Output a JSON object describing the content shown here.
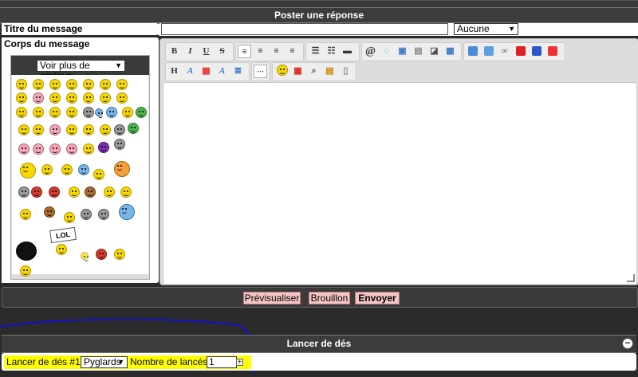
{
  "header": {
    "title": "Poster une réponse"
  },
  "form": {
    "title_label": "Titre du message",
    "title_value": "",
    "icon_select": "Aucune",
    "body_label": "Corps du message",
    "smileys_select": "Voir plus de smileys",
    "lol_sign": "LOL"
  },
  "toolbar": {
    "row1": [
      "bold",
      "italic",
      "underline",
      "strikethrough",
      "align-left",
      "align-center",
      "align-right",
      "justify",
      "bullet-list",
      "numbered-list",
      "horizontal-rule",
      "mention",
      "quote",
      "code",
      "spoiler",
      "hide",
      "table",
      "image",
      "video-host",
      "link",
      "youtube",
      "dailymotion",
      "flash"
    ],
    "row2": [
      "heading",
      "font",
      "color",
      "font-size",
      "more",
      "smiley",
      "date",
      "search",
      "paste",
      "document"
    ],
    "labels": {
      "bold": "B",
      "italic": "I",
      "underline": "U",
      "strike": "S",
      "heading": "H",
      "font": "A"
    }
  },
  "buttons": {
    "preview": "Prévisualiser",
    "draft": "Brouillon",
    "send": "Envoyer"
  },
  "dice": {
    "title": "Lancer de dés",
    "collapse": "−",
    "label": "Lancer de dés #1 :",
    "die": "Pyglards",
    "count_label": "Nombre de lancés :",
    "count_value": "1",
    "add": "+"
  },
  "colors": {
    "accent_yellow": "#ffff00",
    "button_pink": "#f5c6c6",
    "dark_bar": "#3a3a3a"
  }
}
